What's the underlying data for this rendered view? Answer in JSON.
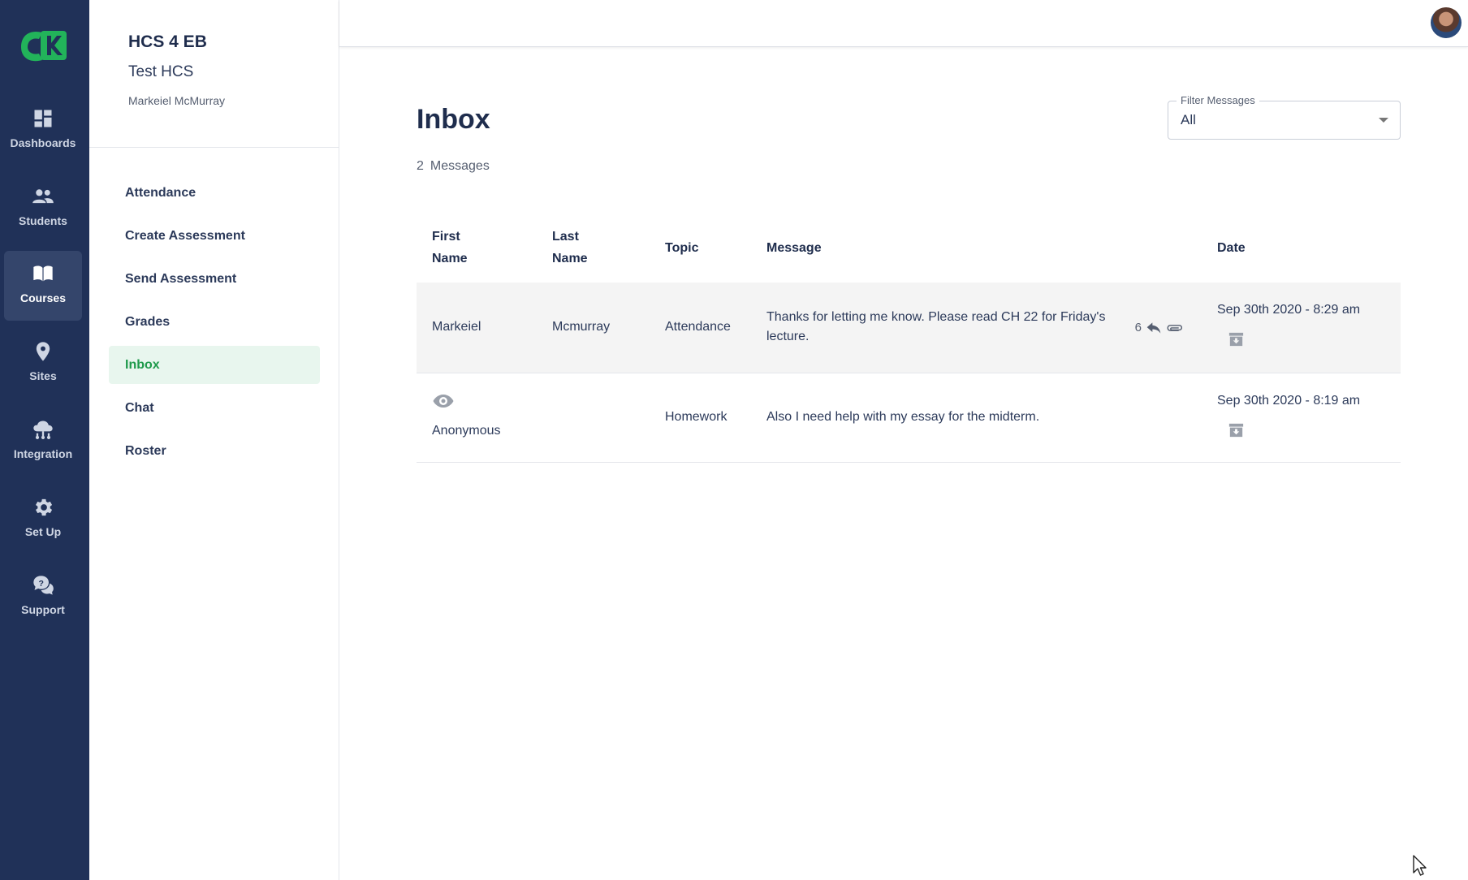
{
  "rail": {
    "items": [
      {
        "label": "Dashboards",
        "icon": "dashboard-icon"
      },
      {
        "label": "Students",
        "icon": "people-icon"
      },
      {
        "label": "Courses",
        "icon": "book-icon",
        "active": true
      },
      {
        "label": "Sites",
        "icon": "location-pin-icon"
      },
      {
        "label": "Integration",
        "icon": "cloud-network-icon"
      },
      {
        "label": "Set Up",
        "icon": "gear-icon"
      },
      {
        "label": "Support",
        "icon": "help-chat-icon"
      }
    ]
  },
  "course": {
    "code": "HCS 4 EB",
    "name": "Test HCS",
    "user": "Markeiel McMurray"
  },
  "nav": {
    "items": [
      {
        "label": "Attendance"
      },
      {
        "label": "Create Assessment"
      },
      {
        "label": "Send Assessment"
      },
      {
        "label": "Grades"
      },
      {
        "label": "Inbox",
        "active": true
      },
      {
        "label": "Chat"
      },
      {
        "label": "Roster"
      }
    ]
  },
  "inbox": {
    "title": "Inbox",
    "count": "2",
    "count_label": "Messages",
    "filter": {
      "label": "Filter Messages",
      "value": "All"
    },
    "columns": {
      "first_name": [
        "First",
        "Name"
      ],
      "last_name": [
        "Last",
        "Name"
      ],
      "topic": "Topic",
      "message": "Message",
      "date": "Date"
    },
    "rows": [
      {
        "first_name": "Markeiel",
        "last_name": "Mcmurray",
        "topic": "Attendance",
        "message": "Thanks for letting me know. Please read CH 22 for Friday's lecture.",
        "reply_count": "6",
        "date": "Sep 30th 2020 - 8:29 am"
      },
      {
        "first_name": "Anonymous",
        "last_name": "",
        "topic": "Homework",
        "message": "Also I need help with my essay for the midterm.",
        "date": "Sep 30th 2020 - 8:19 am"
      }
    ]
  },
  "colors": {
    "rail_bg": "#203158",
    "accent_green": "#1f9a4b",
    "active_nav_bg": "#e8f6ee",
    "row_highlight": "#f4f4f4"
  }
}
